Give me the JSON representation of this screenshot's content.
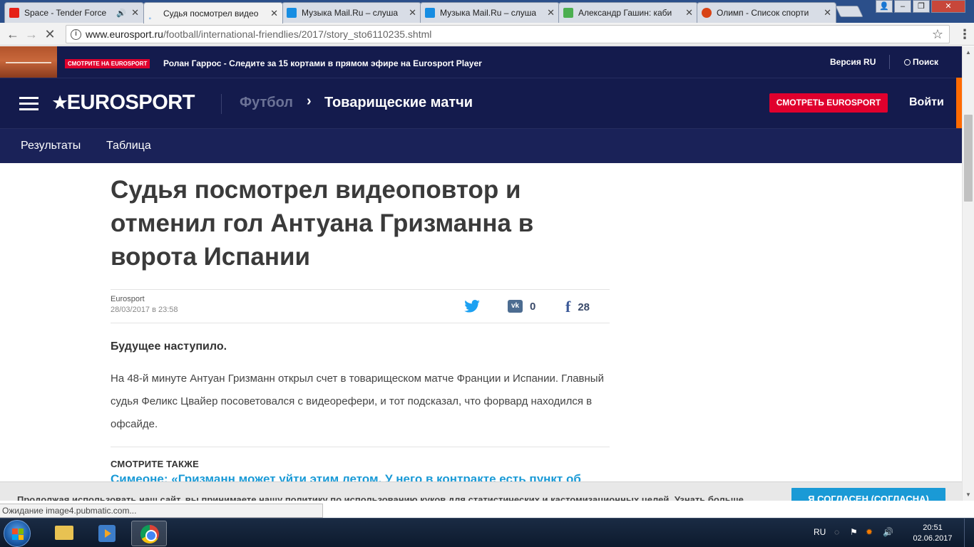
{
  "browser": {
    "tabs": [
      {
        "title": "Space - Tender Force",
        "favicon_color": "#e62117",
        "audio": true
      },
      {
        "title": "Судья посмотрел видео",
        "favicon_color": "#5aa0e8",
        "active": true
      },
      {
        "title": "Музыка Mail.Ru – слуша",
        "favicon_color": "#168de2"
      },
      {
        "title": "Музыка Mail.Ru – слуша",
        "favicon_color": "#168de2"
      },
      {
        "title": "Александр Гашин: каби",
        "favicon_color": "#4caf50"
      },
      {
        "title": "Олимп - Список спорти",
        "favicon_color": "#d84315"
      }
    ],
    "url_host": "www.eurosport.ru",
    "url_path": "/football/international-friendlies/2017/story_sto6110235.shtml",
    "status_text": "Ожидание image4.pubmatic.com..."
  },
  "site": {
    "promo": {
      "badge": "СМОТРИТЕ НА EUROSPORT",
      "message": "Ролан Гаррос - Следите за 15 кортами в прямом эфире на Eurosport Player",
      "version": "Версия RU",
      "search": "Поиск"
    },
    "nav": {
      "logo": "EUROSPORT",
      "breadcrumb_parent": "Футбол",
      "breadcrumb_current": "Товарищеские матчи",
      "watch_button": "СМОТРЕТЬ EUROSPORT",
      "login": "Войти"
    },
    "subnav": [
      "Результаты",
      "Таблица"
    ],
    "accent_red": "#e0002d",
    "accent_orange": "#ff6a00",
    "navy": "#141b4d"
  },
  "article": {
    "headline": "Судья посмотрел видеоповтор и отменил гол Антуана Гризманна в ворота Испании",
    "author": "Eurosport",
    "date": "28/03/2017 в 23:58",
    "share": {
      "vk_count": "0",
      "fb_count": "28"
    },
    "lead": "Будущее наступило.",
    "body": "На 48-й минуте Антуан Гризманн открыл счет в товарищеском матче Франции и Испании. Главный судья Феликс Цвайер посоветовался с видеорефери, и тот подсказал, что форвард находился в офсайде.",
    "see_also_title": "СМОТРИТЕ ТАКЖЕ",
    "see_also_link": "Симеоне: «Гризманн может уйти этим летом. У него в контракте есть пункт об"
  },
  "cookie": {
    "text": "Продолжая использовать наш сайт, вы принимаете нашу политику по использованию куков для статистических и кастомизационных целей.",
    "learn_more": "Узнать больше",
    "agree": "Я СОГЛАСЕН (СОГЛАСНА)"
  },
  "taskbar": {
    "lang": "RU",
    "time": "20:51",
    "date": "02.06.2017"
  }
}
